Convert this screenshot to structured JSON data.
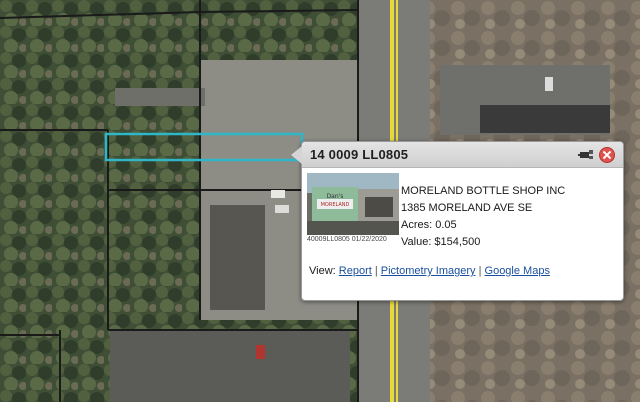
{
  "map": {
    "road_line_color": "#e8d93a",
    "parcel_highlight_color": "#2fb6c7",
    "parcel_line_color": "#1a1a1a"
  },
  "popup": {
    "parcel_id": "14 0009 LL0805",
    "zoom_icon": "zoom-to-icon",
    "close_icon": "close-icon",
    "photo_caption": "40009LL0805 01/22/2020",
    "photo_sign_line1": "Dan's",
    "photo_sign_line2": "MORELAND",
    "owner": "MORELAND BOTTLE SHOP INC",
    "address": "1385 MORELAND AVE SE",
    "acres_line": "Acres: 0.05",
    "value_line": "Value: $154,500",
    "view_label": "View:",
    "links": {
      "report": "Report",
      "pictometry": "Pictometry Imagery",
      "google_maps": "Google Maps"
    },
    "separator": "|"
  }
}
